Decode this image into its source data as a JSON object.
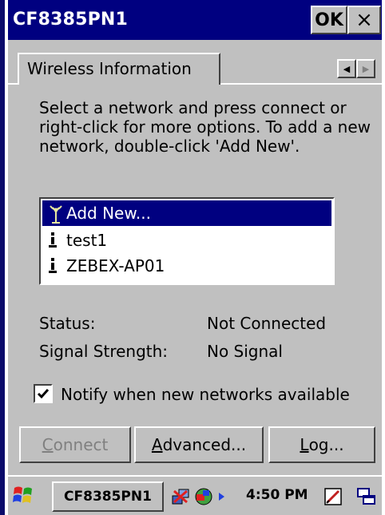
{
  "window": {
    "title": "CF8385PN1",
    "ok_label": "OK",
    "close_label": "×"
  },
  "tabs": {
    "active_label": "Wireless Information",
    "scroll_left": "◀",
    "scroll_right": "▶"
  },
  "description": "Select a network and press connect or right-click for more options.  To add a new network, double-click 'Add New'.",
  "networks": [
    {
      "label": "Add New...",
      "icon": "antenna-icon",
      "selected": true
    },
    {
      "label": "test1",
      "icon": "network-icon",
      "selected": false
    },
    {
      "label": "ZEBEX-AP01",
      "icon": "network-icon",
      "selected": false
    }
  ],
  "status": {
    "status_label": "Status:",
    "status_value": "Not Connected",
    "signal_label": "Signal Strength:",
    "signal_value": "No Signal"
  },
  "notify": {
    "checked": true,
    "label": "Notify when new networks available"
  },
  "buttons": {
    "connect_first": "C",
    "connect_rest": "onnect",
    "advanced_first": "A",
    "advanced_rest": "dvanced...",
    "log_first": "L",
    "log_rest": "og..."
  },
  "taskbar": {
    "task_label": "CF8385PN1",
    "clock": "4:50 PM",
    "start_icon": "windows-flag-icon"
  },
  "colors": {
    "title_bar": "#000080",
    "face": "#c0c0c0",
    "selection": "#000080"
  }
}
